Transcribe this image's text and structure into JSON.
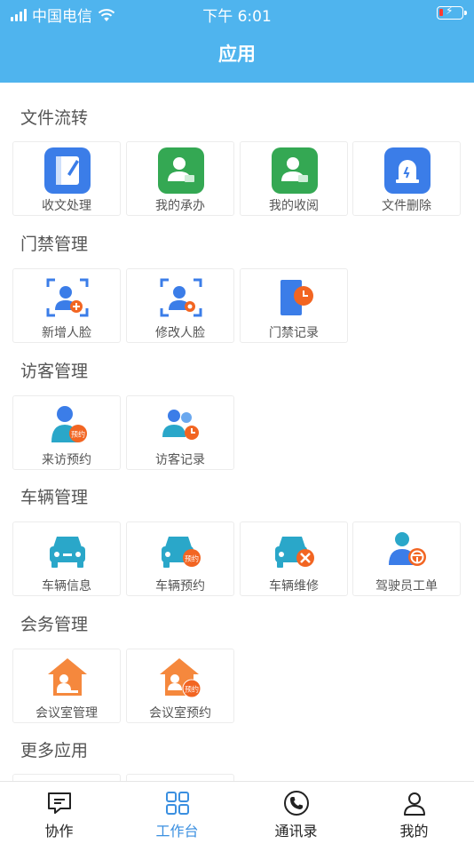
{
  "status_bar": {
    "carrier": "中国电信",
    "time": "下午 6:01"
  },
  "header": {
    "title": "应用"
  },
  "sections": [
    {
      "title": "文件流转",
      "items": [
        {
          "label": "收文处理",
          "icon": "notebook-icon"
        },
        {
          "label": "我的承办",
          "icon": "user-task-icon"
        },
        {
          "label": "我的收阅",
          "icon": "user-read-icon"
        },
        {
          "label": "文件删除",
          "icon": "alarm-delete-icon"
        }
      ]
    },
    {
      "title": "门禁管理",
      "items": [
        {
          "label": "新增人脸",
          "icon": "face-add-icon"
        },
        {
          "label": "修改人脸",
          "icon": "face-edit-icon"
        },
        {
          "label": "门禁记录",
          "icon": "door-record-icon"
        }
      ]
    },
    {
      "title": "访客管理",
      "items": [
        {
          "label": "来访预约",
          "icon": "visitor-reserve-icon",
          "badge": "预约"
        },
        {
          "label": "访客记录",
          "icon": "visitor-record-icon"
        }
      ]
    },
    {
      "title": "车辆管理",
      "items": [
        {
          "label": "车辆信息",
          "icon": "car-icon"
        },
        {
          "label": "车辆预约",
          "icon": "car-reserve-icon",
          "badge": "预约"
        },
        {
          "label": "车辆维修",
          "icon": "car-repair-icon"
        },
        {
          "label": "驾驶员工单",
          "icon": "driver-icon"
        }
      ]
    },
    {
      "title": "会务管理",
      "items": [
        {
          "label": "会议室管理",
          "icon": "meeting-room-icon"
        },
        {
          "label": "会议室预约",
          "icon": "meeting-reserve-icon",
          "badge": "预约"
        }
      ]
    },
    {
      "title": "更多应用",
      "items": []
    }
  ],
  "tabbar": [
    {
      "label": "协作",
      "icon": "chat-icon"
    },
    {
      "label": "工作台",
      "icon": "grid-icon",
      "active": true
    },
    {
      "label": "通讯录",
      "icon": "phone-icon"
    },
    {
      "label": "我的",
      "icon": "person-icon"
    }
  ],
  "colors": {
    "header": "#4fb4ee",
    "active_tab": "#3a8fe0",
    "badge": "#f26522"
  }
}
